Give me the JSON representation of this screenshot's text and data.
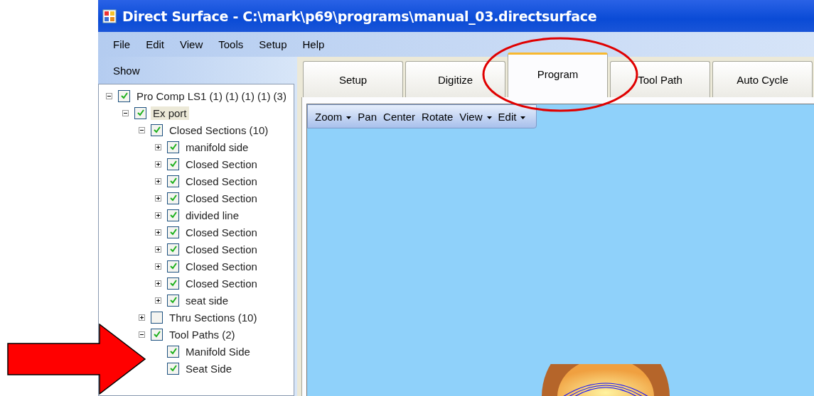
{
  "window": {
    "title": "Direct Surface - C:\\mark\\p69\\programs\\manual_03.directsurface"
  },
  "menu": [
    "File",
    "Edit",
    "View",
    "Tools",
    "Setup",
    "Help"
  ],
  "show_label": "Show",
  "tree": [
    {
      "label": "Pro Comp LS1 (1) (1) (1) (1) (3)",
      "checked": true,
      "expanded": true,
      "selected": false,
      "children": [
        {
          "label": "Ex port",
          "checked": true,
          "expanded": true,
          "selected": true,
          "children": [
            {
              "label": "Closed Sections (10)",
              "checked": true,
              "expanded": true,
              "selected": false,
              "children": [
                {
                  "label": "manifold side",
                  "checked": true,
                  "expanded": false,
                  "selected": false
                },
                {
                  "label": "Closed Section",
                  "checked": true,
                  "expanded": false,
                  "selected": false
                },
                {
                  "label": "Closed Section",
                  "checked": true,
                  "expanded": false,
                  "selected": false
                },
                {
                  "label": "Closed Section",
                  "checked": true,
                  "expanded": false,
                  "selected": false
                },
                {
                  "label": "divided line",
                  "checked": true,
                  "expanded": false,
                  "selected": false
                },
                {
                  "label": "Closed Section",
                  "checked": true,
                  "expanded": false,
                  "selected": false
                },
                {
                  "label": "Closed Section",
                  "checked": true,
                  "expanded": false,
                  "selected": false
                },
                {
                  "label": "Closed Section",
                  "checked": true,
                  "expanded": false,
                  "selected": false
                },
                {
                  "label": "Closed Section",
                  "checked": true,
                  "expanded": false,
                  "selected": false
                },
                {
                  "label": "seat side",
                  "checked": true,
                  "expanded": false,
                  "selected": false
                }
              ]
            },
            {
              "label": "Thru Sections (10)",
              "checked": false,
              "expanded": false,
              "selected": false
            },
            {
              "label": "Tool Paths (2)",
              "checked": true,
              "expanded": true,
              "selected": false,
              "children": [
                {
                  "label": "Manifold Side",
                  "checked": true,
                  "selected": false
                },
                {
                  "label": "Seat Side",
                  "checked": true,
                  "selected": false
                }
              ]
            }
          ]
        }
      ]
    }
  ],
  "tabs": [
    {
      "label": "Setup",
      "selected": false
    },
    {
      "label": "Digitize",
      "selected": false
    },
    {
      "label": "Program",
      "selected": true
    },
    {
      "label": "Tool Path",
      "selected": false
    },
    {
      "label": "Auto Cycle",
      "selected": false
    }
  ],
  "toolbar": [
    {
      "label": "Zoom",
      "dropdown": true
    },
    {
      "label": "Pan",
      "dropdown": false
    },
    {
      "label": "Center",
      "dropdown": false
    },
    {
      "label": "Rotate",
      "dropdown": false
    },
    {
      "label": "View",
      "dropdown": true
    },
    {
      "label": "Edit",
      "dropdown": true
    }
  ]
}
